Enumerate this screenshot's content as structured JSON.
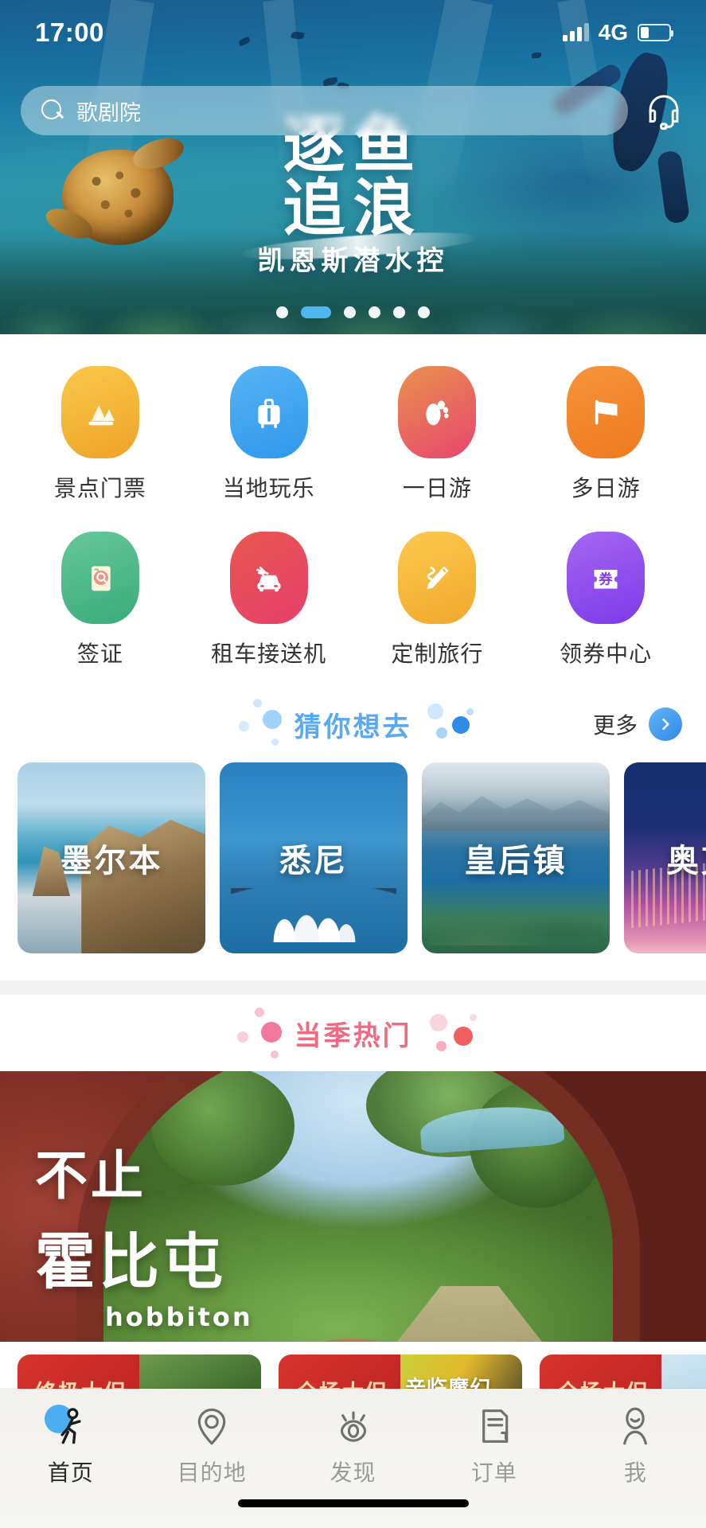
{
  "status_bar": {
    "time": "17:00",
    "network": "4G",
    "signal_icon": "signal-bars-icon",
    "battery_icon": "battery-low-icon"
  },
  "search": {
    "placeholder": "歌剧院",
    "search_icon": "search-icon",
    "service_icon": "headset-customer-service-icon"
  },
  "hero": {
    "title_line1": "逐鱼",
    "title_line2": "追浪",
    "subtitle": "凯恩斯潜水控",
    "dots_total": 6,
    "dots_active_index": 1
  },
  "quick_links": [
    {
      "label": "景点门票",
      "icon": "mountain-ticket-icon",
      "color": "#f0aa2c"
    },
    {
      "label": "当地玩乐",
      "icon": "suitcase-icon",
      "color": "#3f9fef"
    },
    {
      "label": "一日游",
      "icon": "footprint-icon",
      "color": "#e8546a"
    },
    {
      "label": "多日游",
      "icon": "flag-icon",
      "color": "#f0821f"
    },
    {
      "label": "签证",
      "icon": "passport-stamp-icon",
      "color": "#4db089"
    },
    {
      "label": "租车接送机",
      "icon": "car-airport-transfer-icon",
      "color": "#e5485d"
    },
    {
      "label": "定制旅行",
      "icon": "pencil-custom-trip-icon",
      "color": "#f5b833"
    },
    {
      "label": "领券中心",
      "icon": "coupon-icon",
      "color": "#8d4aec"
    }
  ],
  "guess_section": {
    "title": "猜你想去",
    "more_label": "更多",
    "more_icon": "chevron-right-circle-icon",
    "accent_color": "#5aa8f2",
    "destinations": [
      {
        "name": "墨尔本"
      },
      {
        "name": "悉尼"
      },
      {
        "name": "皇后镇"
      },
      {
        "name": "奥克兰"
      }
    ]
  },
  "hot_section": {
    "title": "当季热门",
    "accent_color": "#f06a82"
  },
  "promo_banner": {
    "line1": "不止",
    "line2": "霍比屯",
    "line3": "hobbiton"
  },
  "promo_strip": [
    {
      "badge": "终极大促"
    },
    {
      "badge": "全场大促",
      "overlay": "辛临魔幻"
    },
    {
      "badge": "全场大促"
    }
  ],
  "tabbar": [
    {
      "label": "首页",
      "icon": "home-running-icon",
      "active": true
    },
    {
      "label": "目的地",
      "icon": "map-pin-icon",
      "active": false
    },
    {
      "label": "发现",
      "icon": "eye-discover-icon",
      "active": false
    },
    {
      "label": "订单",
      "icon": "order-document-icon",
      "active": false
    },
    {
      "label": "我",
      "icon": "user-profile-icon",
      "active": false
    }
  ]
}
